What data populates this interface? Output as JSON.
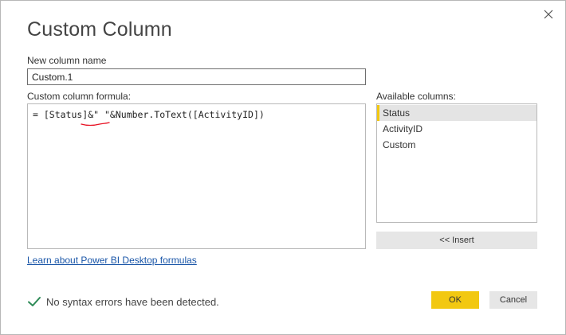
{
  "dialog": {
    "title": "Custom Column",
    "close_icon": "close-icon"
  },
  "name_field": {
    "label": "New column name",
    "value": "Custom.1"
  },
  "formula": {
    "label": "Custom column formula:",
    "text": "= [Status]&\" \"&Number.ToText([ActivityID])",
    "squiggle_color": "#e81123"
  },
  "available_columns": {
    "label": "Available columns:",
    "items": [
      {
        "label": "Status",
        "selected": true
      },
      {
        "label": "ActivityID",
        "selected": false
      },
      {
        "label": "Custom",
        "selected": false
      }
    ],
    "insert_label": "<< Insert"
  },
  "learn_link": "Learn about Power BI Desktop formulas",
  "status": {
    "icon": "checkmark-icon",
    "text": "No syntax errors have been detected.",
    "color": "#2e8b57"
  },
  "buttons": {
    "ok_label": "OK",
    "cancel_label": "Cancel"
  },
  "colors": {
    "accent": "#f2c811",
    "link": "#1a56a8"
  }
}
